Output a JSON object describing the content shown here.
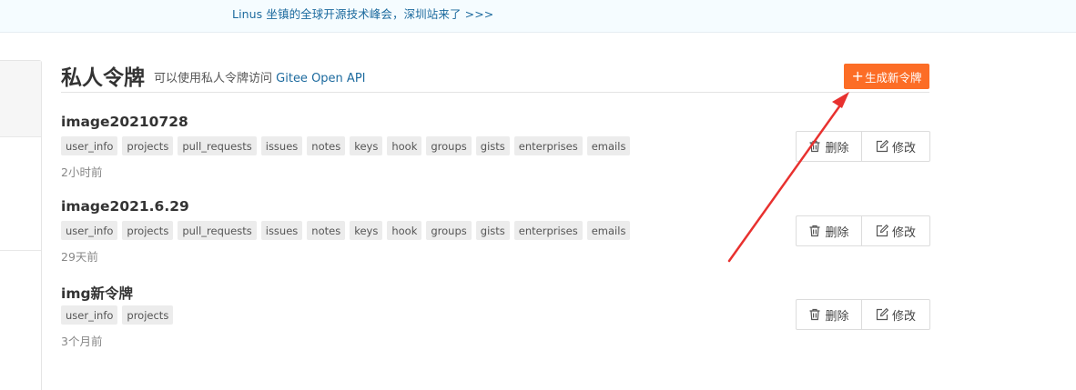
{
  "banner": {
    "text": "Linus 坐镇的全球开源技术峰会，深圳站来了 >>>"
  },
  "header": {
    "title": "私人令牌",
    "description": "可以使用私人令牌访问",
    "api_link": "Gitee Open API"
  },
  "generate_button": {
    "plus": "+",
    "label": "生成新令牌"
  },
  "tokens": [
    {
      "name": "image20210728",
      "scopes": [
        "user_info",
        "projects",
        "pull_requests",
        "issues",
        "notes",
        "keys",
        "hook",
        "groups",
        "gists",
        "enterprises",
        "emails"
      ],
      "time": "2小时前",
      "delete_label": "删除",
      "edit_label": "修改"
    },
    {
      "name": "image2021.6.29",
      "scopes": [
        "user_info",
        "projects",
        "pull_requests",
        "issues",
        "notes",
        "keys",
        "hook",
        "groups",
        "gists",
        "enterprises",
        "emails"
      ],
      "time": "29天前",
      "delete_label": "删除",
      "edit_label": "修改"
    },
    {
      "name": "img新令牌",
      "scopes": [
        "user_info",
        "projects"
      ],
      "time": "3个月前",
      "delete_label": "删除",
      "edit_label": "修改"
    }
  ],
  "annotation": {
    "arrow_color": "#e8312f"
  },
  "colors": {
    "accent": "#fc6d26",
    "link": "#1c6a9e"
  }
}
